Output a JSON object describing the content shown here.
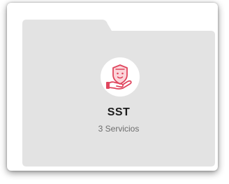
{
  "card": {
    "title": "SST",
    "subtitle": "3 Servicios",
    "icon": "shield-hand-icon"
  },
  "colors": {
    "folder_bg": "#e3e3e3",
    "icon_accent": "#e0465e",
    "badge_bg": "#ffffff"
  }
}
